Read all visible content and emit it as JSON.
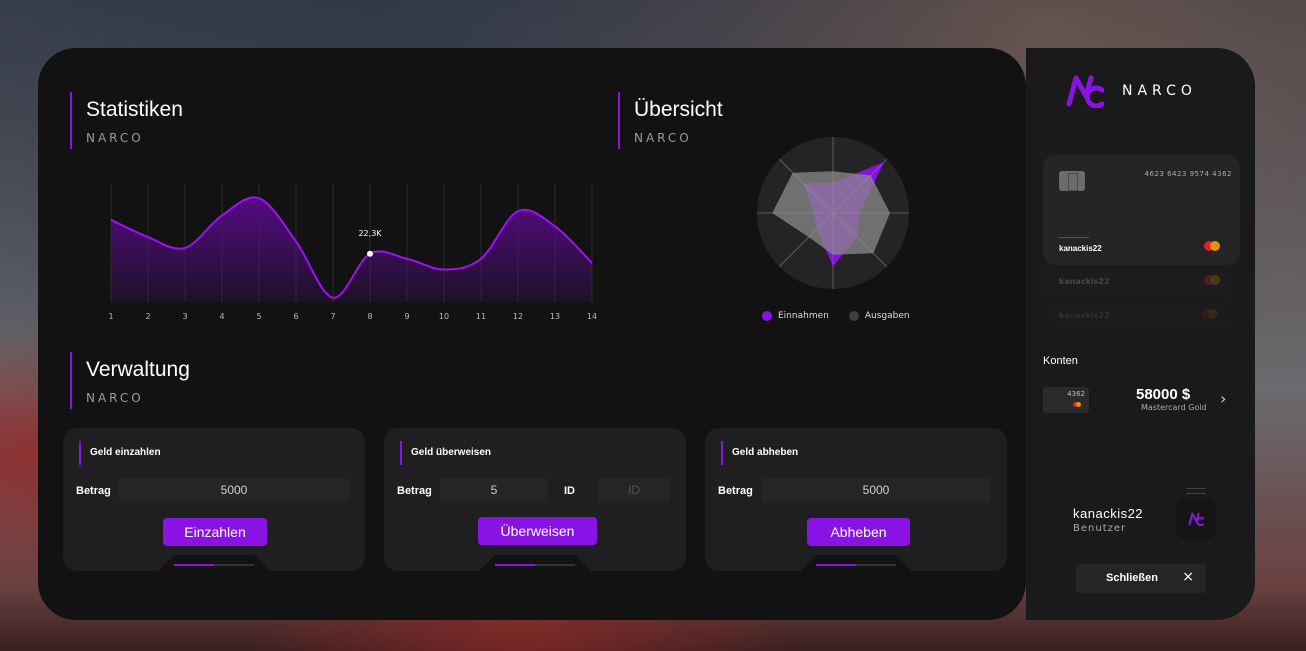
{
  "brand": {
    "name": "NARCO",
    "logo_text": "NC"
  },
  "sections": {
    "statistiken": {
      "title": "Statistiken",
      "subtitle": "NARCO"
    },
    "uebersicht": {
      "title": "Übersicht",
      "subtitle": "NARCO"
    },
    "verwaltung": {
      "title": "Verwaltung",
      "subtitle": "NARCO"
    }
  },
  "chart_data": [
    {
      "type": "area",
      "x": [
        1,
        2,
        3,
        4,
        5,
        6,
        7,
        8,
        9,
        10,
        11,
        12,
        13,
        14
      ],
      "series": [
        {
          "values": [
            38,
            30,
            25,
            40,
            48,
            28,
            2,
            22.3,
            20,
            15,
            20,
            42,
            35,
            18
          ]
        }
      ],
      "ylim": [
        0,
        55
      ],
      "annotations": [
        {
          "x": 8,
          "label": "22,3K"
        }
      ],
      "grid": true,
      "colors": {
        "line": "#a10ff5",
        "fill": "#5a0a8a"
      }
    },
    {
      "type": "radar",
      "axes": 8,
      "rmax": 100,
      "series": [
        {
          "name": "Einnahmen",
          "color": "#8b12e4",
          "values": [
            40,
            95,
            35,
            45,
            70,
            30,
            25,
            55
          ]
        },
        {
          "name": "Ausgaben",
          "color": "#8a8a8a",
          "values": [
            55,
            70,
            75,
            75,
            55,
            45,
            80,
            75
          ]
        }
      ],
      "legend": "bottom"
    }
  ],
  "actions": [
    {
      "title": "Geld einzahlen",
      "amount_label": "Betrag",
      "amount_value": "5000",
      "button": "Einzahlen"
    },
    {
      "title": "Geld überweisen",
      "amount_label": "Betrag",
      "amount_value": "5",
      "id_label": "ID",
      "id_placeholder": "ID",
      "button": "Überweisen"
    },
    {
      "title": "Geld abheben",
      "amount_label": "Betrag",
      "amount_value": "5000",
      "button": "Abheben"
    }
  ],
  "card": {
    "number": "4623 6423 9574 4362",
    "holder": "kanackis22",
    "ghost_holder_1": "kanackis22",
    "ghost_holder_2": "kanackis22"
  },
  "konten": {
    "title": "Konten",
    "card_last4": "4362",
    "amount": "58000 $",
    "card_type": "Mastercard Gold"
  },
  "user": {
    "name": "kanackis22",
    "role": "Benutzer"
  },
  "close": {
    "label": "Schließen",
    "icon": "×"
  },
  "colors": {
    "accent": "#8b12e4",
    "panel": "#121213",
    "side": "#1a1a1c"
  }
}
